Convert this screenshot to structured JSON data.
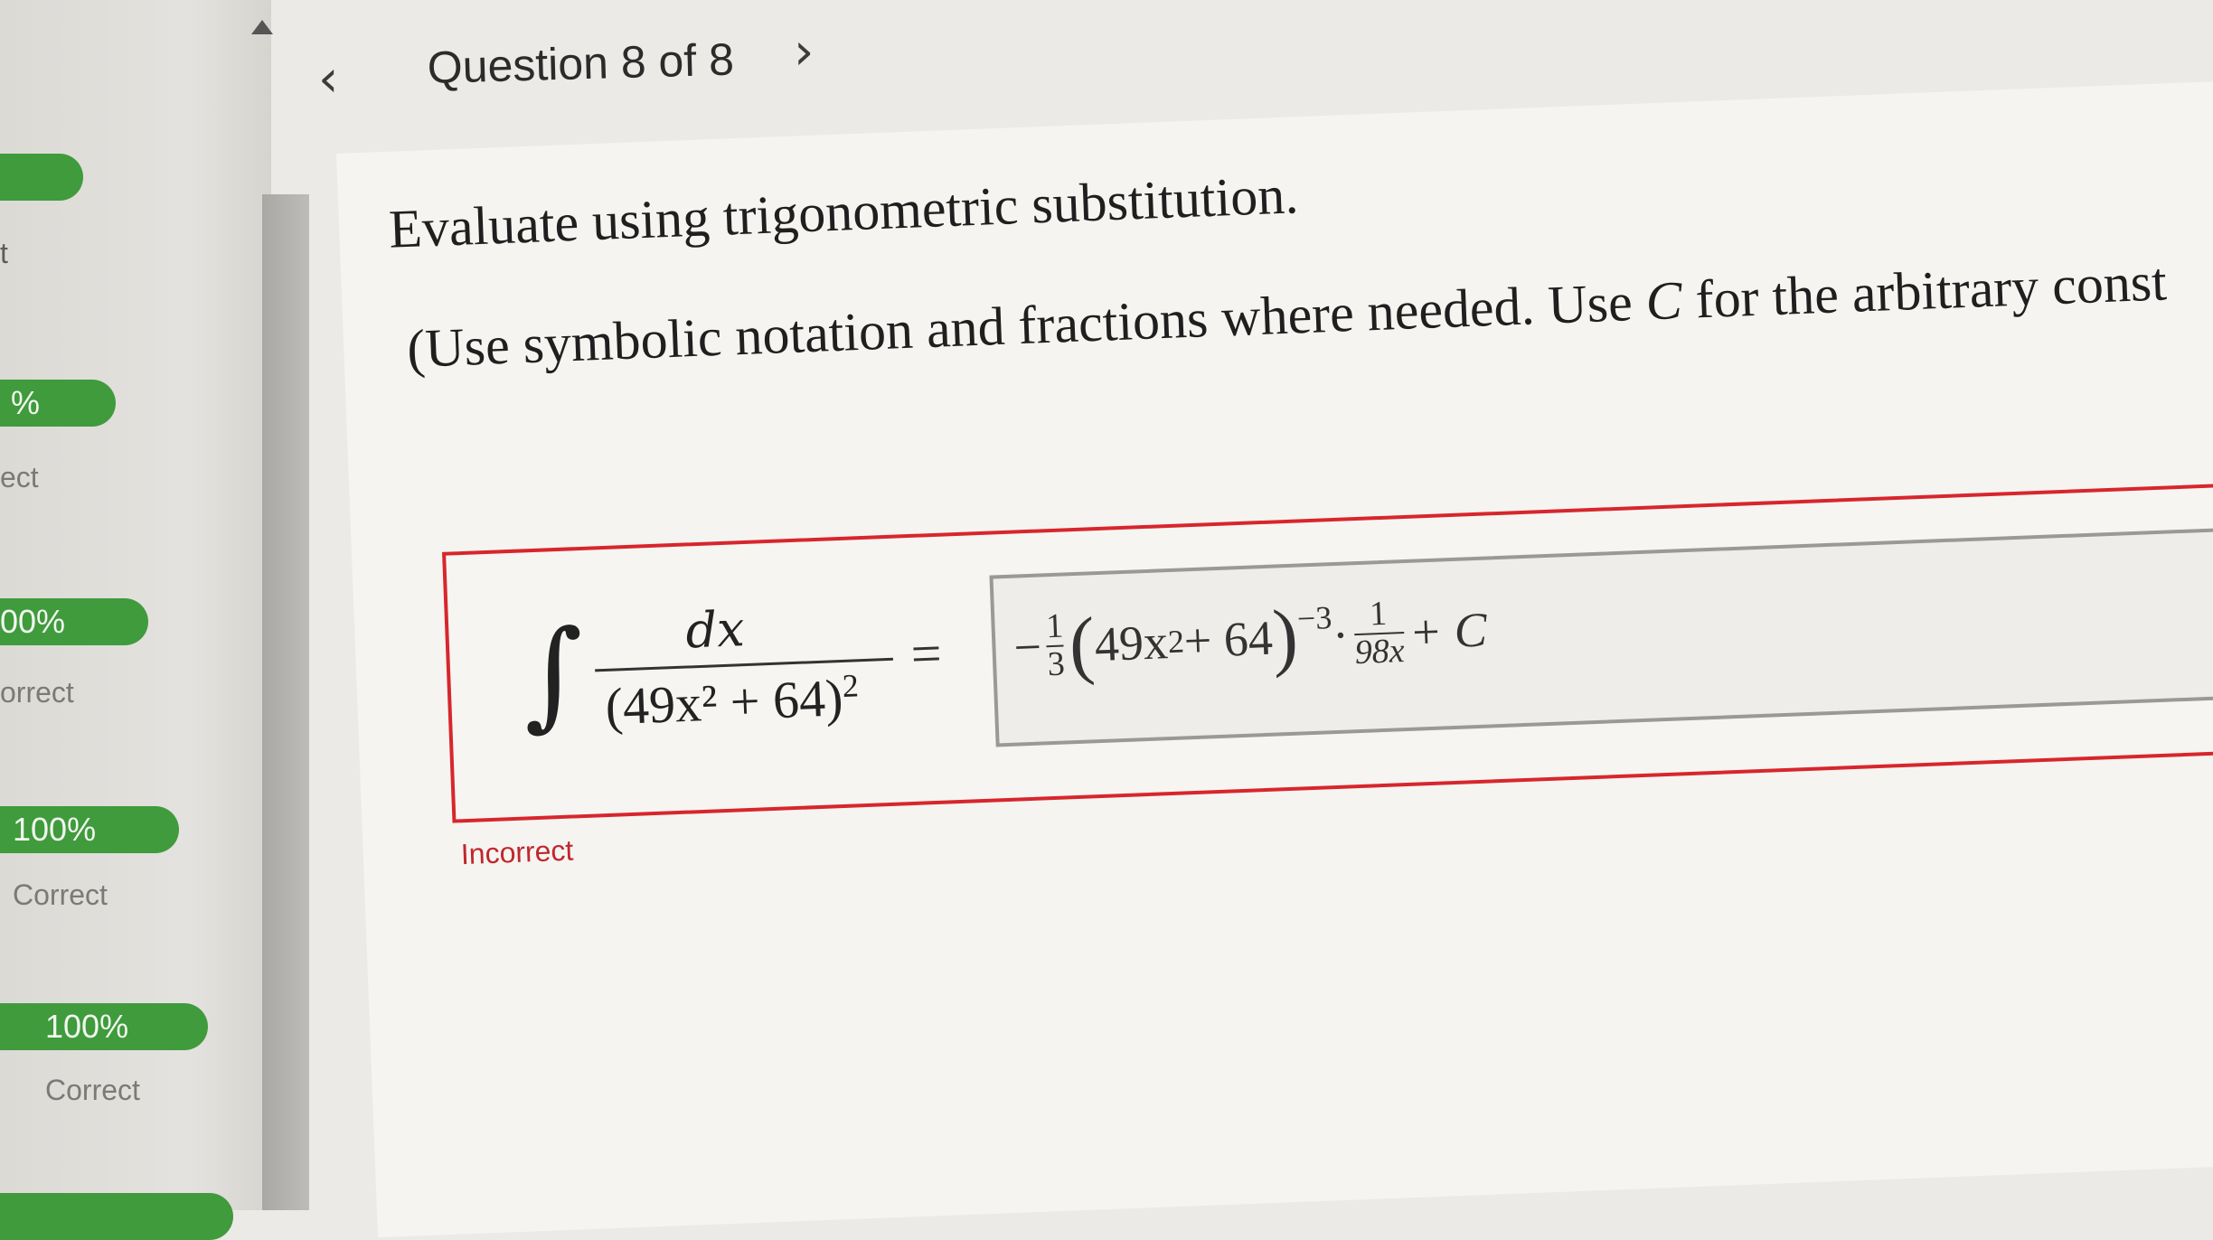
{
  "sidebar": {
    "items": [
      {
        "score": "",
        "status": "t"
      },
      {
        "score": "%",
        "status": "ect"
      },
      {
        "score": "00%",
        "status": "orrect"
      },
      {
        "score": "100%",
        "status": "Correct"
      },
      {
        "score": "100%",
        "status": "Correct"
      }
    ]
  },
  "header": {
    "title": "Question 8 of 8",
    "prev_icon": "chevron-left-icon",
    "next_icon": "chevron-right-icon"
  },
  "question": {
    "prompt": "Evaluate using trigonometric substitution.",
    "instruction_pre": "(Use symbolic notation and fractions where needed. Use ",
    "instruction_var": "C",
    "instruction_post": " for the arbitrary const",
    "integral_numerator": "dx",
    "integral_denominator_base": "(49x² + 64)",
    "integral_denominator_power": "2",
    "equals": "=",
    "answer": {
      "sign": "−",
      "coef_num": "1",
      "coef_den": "3",
      "paren_open": "(",
      "base": "49x",
      "base_power": "2",
      "plus64": " + 64",
      "paren_close": ")",
      "power": "−3",
      "dot": " · ",
      "frac_num": "1",
      "frac_den": "98x",
      "tail": " + C"
    },
    "feedback": "Incorrect"
  },
  "colors": {
    "correct_green": "#3f9b3c",
    "error_red": "#d7262c"
  }
}
